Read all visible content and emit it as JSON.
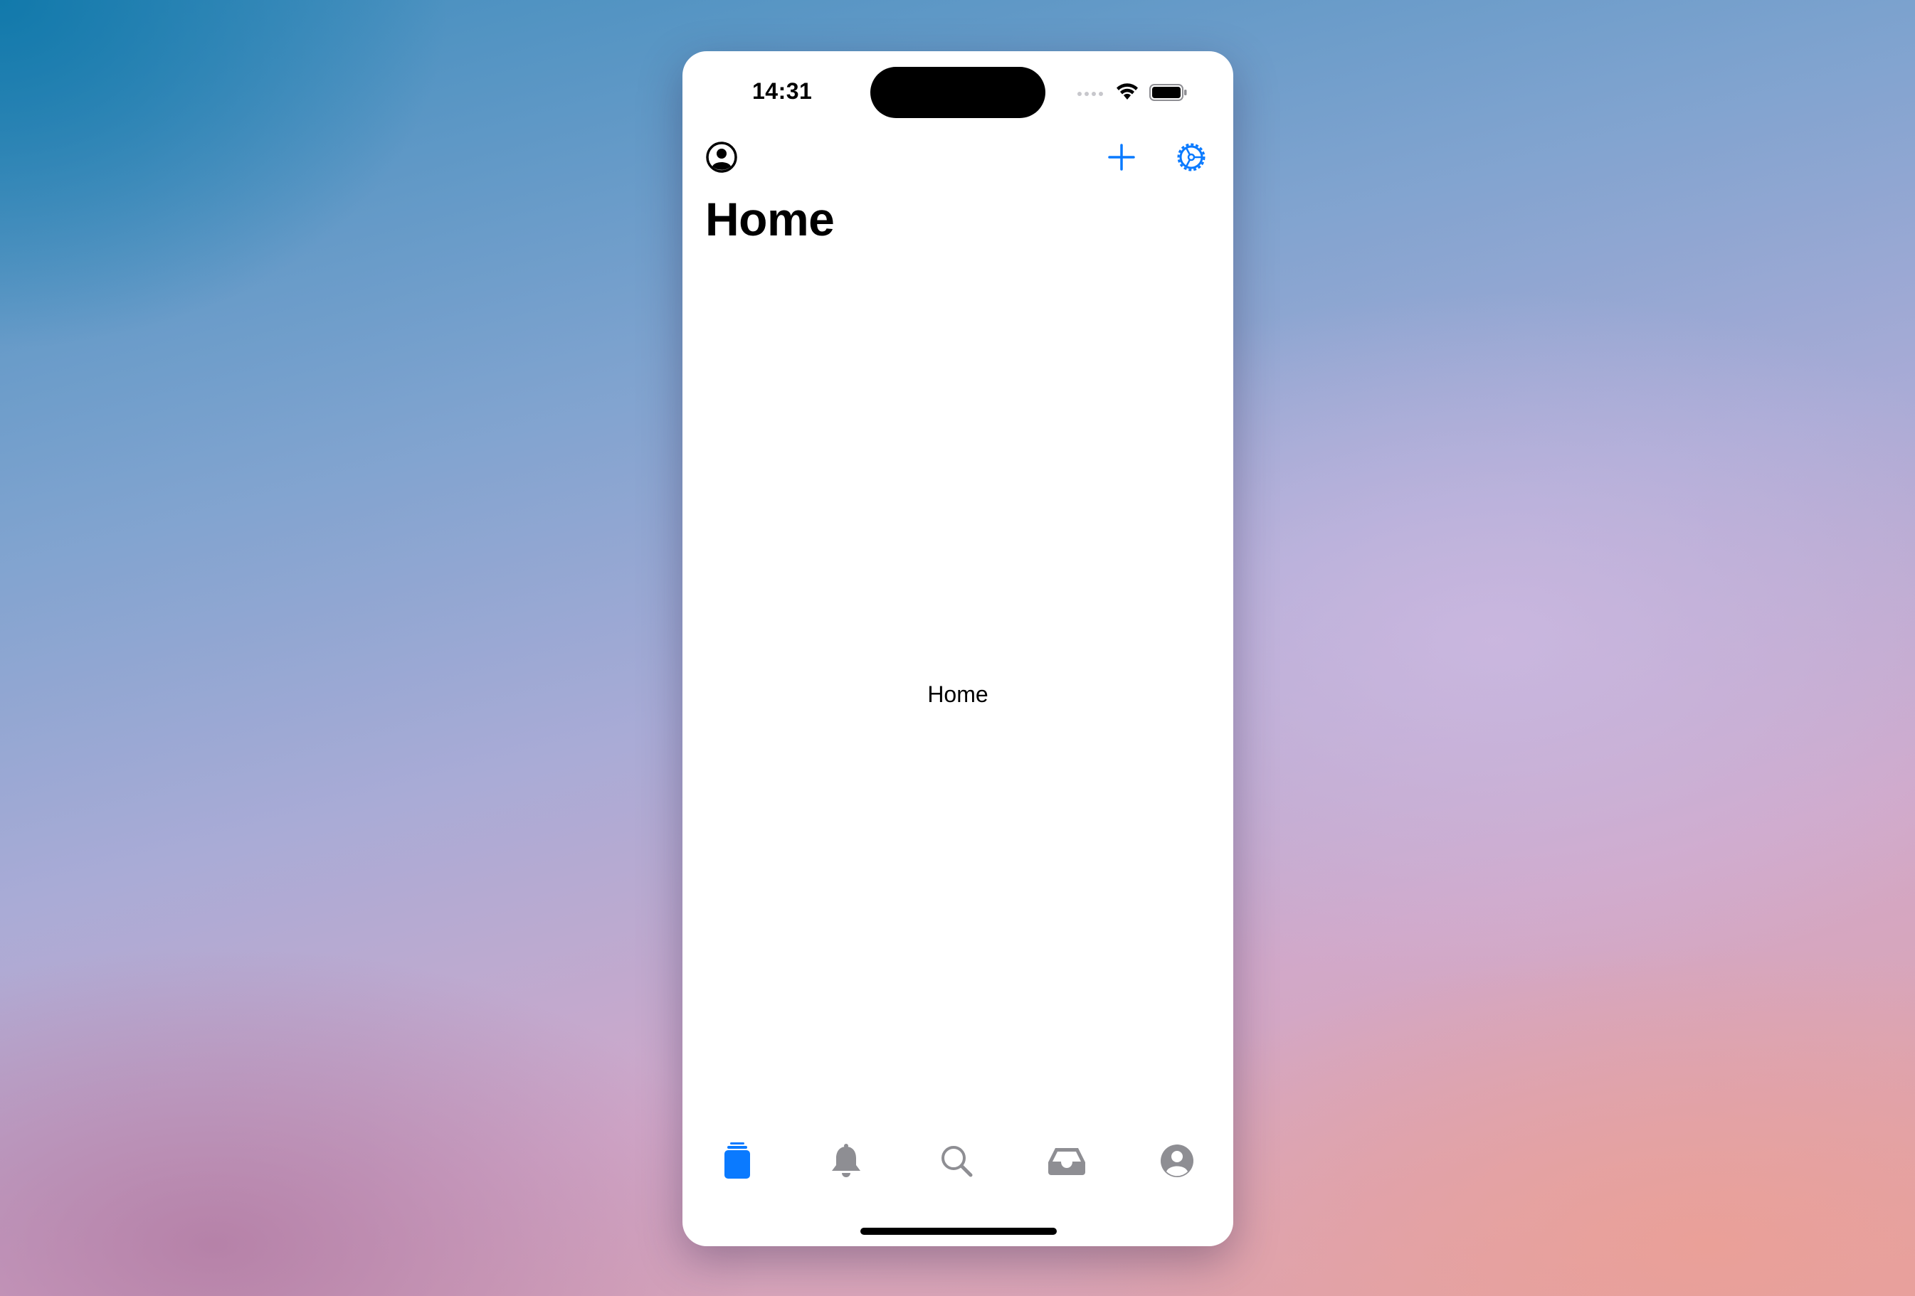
{
  "status_bar": {
    "time": "14:31"
  },
  "nav_bar": {
    "title": "Home"
  },
  "main": {
    "content_label": "Home"
  },
  "tab_bar": {
    "items": [
      {
        "icon": "stack-icon",
        "selected": true
      },
      {
        "icon": "bell-icon",
        "selected": false
      },
      {
        "icon": "search-icon",
        "selected": false
      },
      {
        "icon": "tray-icon",
        "selected": false
      },
      {
        "icon": "person-icon",
        "selected": false
      }
    ]
  },
  "colors": {
    "accent": "#0A7AFF",
    "inactive_tab": "#8E8E93",
    "text": "#000000",
    "background": "#FFFFFF"
  }
}
